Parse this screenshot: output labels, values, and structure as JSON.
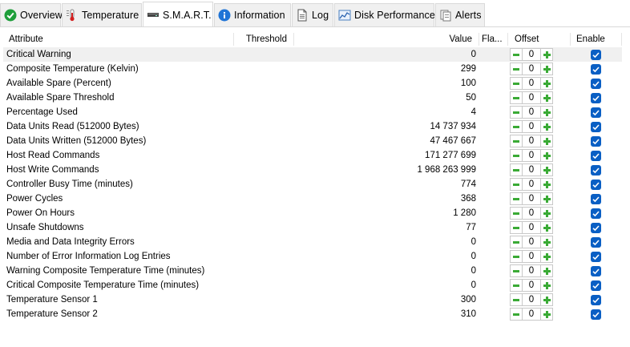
{
  "tabs": [
    {
      "label": "Overview",
      "icon": "green-check-circle-icon"
    },
    {
      "label": "Temperature",
      "icon": "thermometer-icon"
    },
    {
      "label": "S.M.A.R.T.",
      "icon": "drive-icon",
      "active": true
    },
    {
      "label": "Information",
      "icon": "info-icon"
    },
    {
      "label": "Log",
      "icon": "document-icon"
    },
    {
      "label": "Disk Performance",
      "icon": "chart-icon"
    },
    {
      "label": "Alerts",
      "icon": "alerts-icon"
    }
  ],
  "columns": {
    "attribute": "Attribute",
    "threshold": "Threshold",
    "value": "Value",
    "flags": "Fla...",
    "offset": "Offset",
    "enable": "Enable"
  },
  "rows": [
    {
      "name": "Critical Warning",
      "value": "0",
      "offset": "0",
      "enabled": true
    },
    {
      "name": "Composite Temperature (Kelvin)",
      "value": "299",
      "offset": "0",
      "enabled": true
    },
    {
      "name": "Available Spare (Percent)",
      "value": "100",
      "offset": "0",
      "enabled": true
    },
    {
      "name": "Available Spare Threshold",
      "value": "50",
      "offset": "0",
      "enabled": true
    },
    {
      "name": "Percentage Used",
      "value": "4",
      "offset": "0",
      "enabled": true
    },
    {
      "name": "Data Units Read (512000 Bytes)",
      "value": "14 737 934",
      "offset": "0",
      "enabled": true
    },
    {
      "name": "Data Units Written (512000 Bytes)",
      "value": "47 467 667",
      "offset": "0",
      "enabled": true
    },
    {
      "name": "Host Read Commands",
      "value": "171 277 699",
      "offset": "0",
      "enabled": true
    },
    {
      "name": "Host Write Commands",
      "value": "1 968 263 999",
      "offset": "0",
      "enabled": true
    },
    {
      "name": "Controller Busy Time (minutes)",
      "value": "774",
      "offset": "0",
      "enabled": true
    },
    {
      "name": "Power Cycles",
      "value": "368",
      "offset": "0",
      "enabled": true
    },
    {
      "name": "Power On Hours",
      "value": "1 280",
      "offset": "0",
      "enabled": true
    },
    {
      "name": "Unsafe Shutdowns",
      "value": "77",
      "offset": "0",
      "enabled": true
    },
    {
      "name": "Media and Data Integrity Errors",
      "value": "0",
      "offset": "0",
      "enabled": true
    },
    {
      "name": "Number of Error Information Log Entries",
      "value": "0",
      "offset": "0",
      "enabled": true
    },
    {
      "name": "Warning Composite Temperature Time (minutes)",
      "value": "0",
      "offset": "0",
      "enabled": true
    },
    {
      "name": "Critical Composite Temperature Time (minutes)",
      "value": "0",
      "offset": "0",
      "enabled": true
    },
    {
      "name": "Temperature Sensor 1",
      "value": "300",
      "offset": "0",
      "enabled": true
    },
    {
      "name": "Temperature Sensor 2",
      "value": "310",
      "offset": "0",
      "enabled": true
    }
  ],
  "colors": {
    "accent": "#0a5fc4",
    "stepper_green": "#3aaa35",
    "selected_row": "#f0f0f0"
  }
}
